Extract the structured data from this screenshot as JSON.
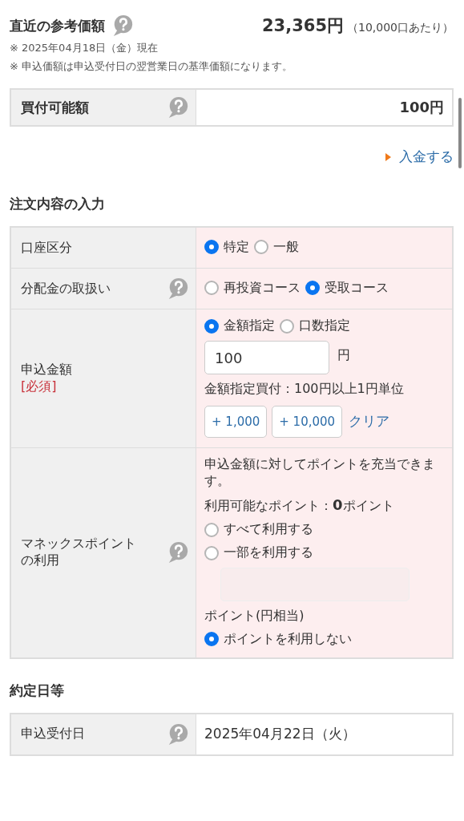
{
  "reference_price": {
    "label": "直近の参考価額",
    "help": true,
    "price": "23,365円",
    "unit_note": "（10,000口あたり）",
    "notes": [
      "※ 2025年04月18日（金）現在",
      "※ 申込価額は申込受付日の翌営業日の基準価額になります。"
    ]
  },
  "buying_power": {
    "label": "買付可能額",
    "help": true,
    "value": "100円"
  },
  "deposit_link": "入金する",
  "order_section": {
    "title": "注文内容の入力",
    "rows": [
      {
        "label": "口座区分",
        "help": false,
        "controls": [
          {
            "kind": "radios",
            "options": [
              {
                "label": "特定",
                "selected": true
              },
              {
                "label": "一般",
                "selected": false
              }
            ]
          }
        ]
      },
      {
        "label": "分配金の取扱い",
        "help": true,
        "controls": [
          {
            "kind": "radios",
            "options": [
              {
                "label": "再投資コース",
                "selected": false
              },
              {
                "label": "受取コース",
                "selected": true
              }
            ]
          }
        ]
      },
      {
        "label": "申込金額",
        "required": "[必須]",
        "help": false,
        "controls": [
          {
            "kind": "radios",
            "options": [
              {
                "label": "金額指定",
                "selected": true
              },
              {
                "label": "口数指定",
                "selected": false
              }
            ]
          },
          {
            "kind": "input",
            "value": "100",
            "unit": "円",
            "disabled": false
          },
          {
            "kind": "text",
            "text": "金額指定買付：100円以上1円単位"
          },
          {
            "kind": "buttons",
            "buttons": [
              "+ 1,000",
              "+ 10,000"
            ],
            "link": "クリア"
          }
        ]
      },
      {
        "label": "マネックスポイントの利用",
        "help": true,
        "controls": [
          {
            "kind": "text",
            "text": "申込金額に対してポイントを充当できます。"
          },
          {
            "kind": "text",
            "text": "利用可能なポイント：**0**ポイント"
          },
          {
            "kind": "radio",
            "label": "すべて利用する",
            "selected": false
          },
          {
            "kind": "radio",
            "label": "一部を利用する",
            "selected": false
          },
          {
            "kind": "input",
            "disabled": true
          },
          {
            "kind": "text",
            "text": "ポイント(円相当)"
          },
          {
            "kind": "radio",
            "label": "ポイントを利用しない",
            "selected": true
          }
        ]
      }
    ]
  },
  "settlement_section": {
    "title": "約定日等",
    "rows": [
      {
        "label": "申込受付日",
        "help": true,
        "value": "2025年04月22日（火）"
      }
    ]
  }
}
